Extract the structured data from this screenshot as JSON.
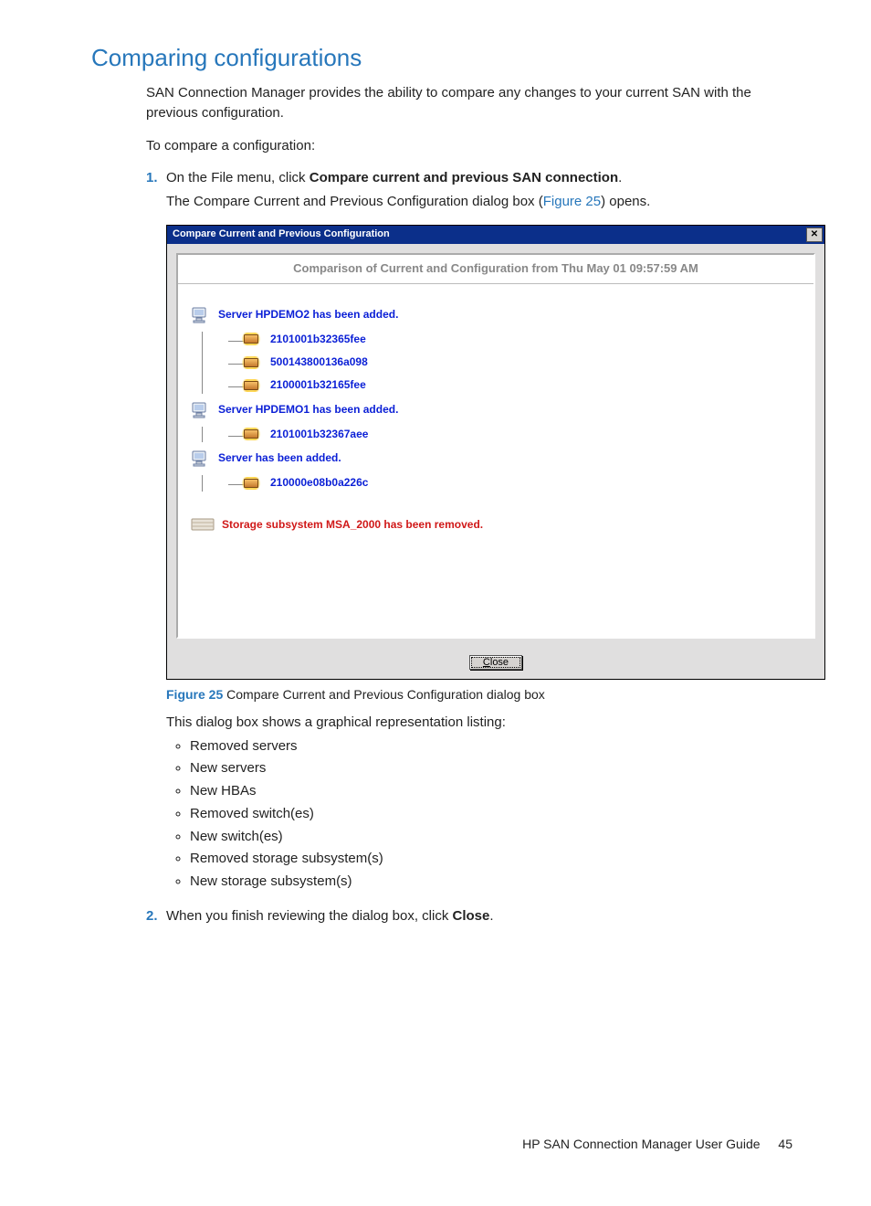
{
  "title": "Comparing configurations",
  "intro": "SAN Connection Manager provides the ability to compare any changes to your current SAN with the previous configuration.",
  "lead": "To compare a configuration:",
  "step1": {
    "pre": "On the File menu, click ",
    "cmd": "Compare current and previous SAN connection",
    "post": ".",
    "sub_pre": "The Compare Current and Previous Configuration dialog box (",
    "sub_link": "Figure 25",
    "sub_post": ") opens."
  },
  "dialog": {
    "title": "Compare Current and Previous Configuration",
    "header": "Comparison of Current and Configuration from Thu May 01 09:57:59 AM",
    "close_btn": "Close",
    "nodes": [
      {
        "type": "server",
        "label": "Server HPDEMO2 has been added.",
        "color": "blue",
        "children": [
          {
            "label": "2101001b32365fee"
          },
          {
            "label": "500143800136a098"
          },
          {
            "label": "2100001b32165fee"
          }
        ]
      },
      {
        "type": "server",
        "label": "Server HPDEMO1 has been added.",
        "color": "blue",
        "children": [
          {
            "label": "2101001b32367aee"
          }
        ]
      },
      {
        "type": "server",
        "label": "Server  has been added.",
        "color": "blue",
        "children": [
          {
            "label": "210000e08b0a226c"
          }
        ]
      },
      {
        "type": "storage",
        "label": "Storage subsystem MSA_2000 has been removed.",
        "color": "red",
        "children": []
      }
    ]
  },
  "caption": {
    "label": "Figure 25",
    "text": " Compare Current and Previous Configuration dialog box"
  },
  "after_fig": "This dialog box shows a graphical representation listing:",
  "bullets": [
    "Removed servers",
    "New servers",
    "New HBAs",
    "Removed switch(es)",
    "New switch(es)",
    "Removed storage subsystem(s)",
    "New storage subsystem(s)"
  ],
  "step2_pre": "When you finish reviewing the dialog box, click ",
  "step2_bold": "Close",
  "step2_post": ".",
  "footer_doc": "HP SAN Connection Manager User Guide",
  "footer_page": "45"
}
